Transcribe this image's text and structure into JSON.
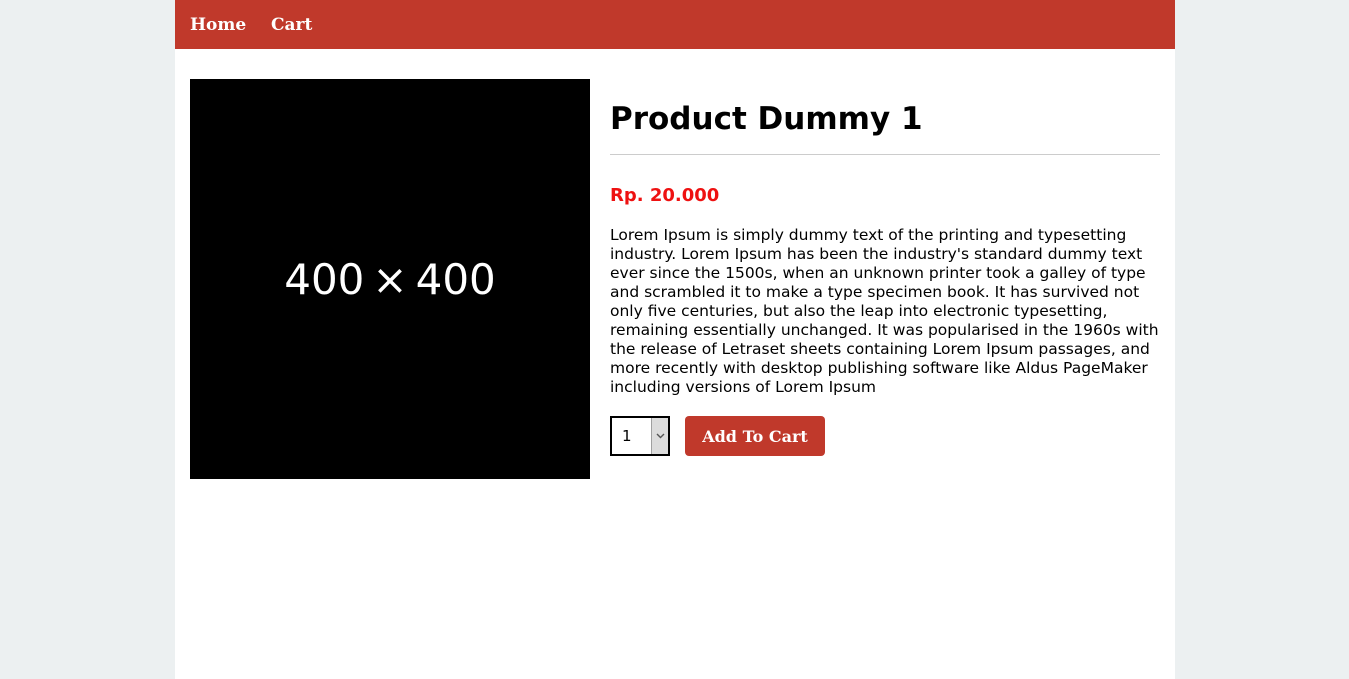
{
  "nav": {
    "home_label": "Home",
    "cart_label": "Cart"
  },
  "product": {
    "image_placeholder_w": "400",
    "image_placeholder_sep": "×",
    "image_placeholder_h": "400",
    "title": "Product Dummy 1",
    "price": "Rp. 20.000",
    "description": "Lorem Ipsum is simply dummy text of the printing and typesetting industry. Lorem Ipsum has been the industry's standard dummy text ever since the 1500s, when an unknown printer took a galley of type and scrambled it to make a type specimen book. It has survived not only five centuries, but also the leap into electronic typesetting, remaining essentially unchanged. It was popularised in the 1960s with the release of Letraset sheets containing Lorem Ipsum passages, and more recently with desktop publishing software like Aldus PageMaker including versions of Lorem Ipsum"
  },
  "cart_form": {
    "quantity_selected": "1",
    "add_button_label": "Add To Cart"
  },
  "colors": {
    "brand": "#c0392b",
    "price": "#ee1111",
    "page_background": "#ecf0f1"
  },
  "icons": {
    "select_arrow": "chevron-down-icon"
  }
}
